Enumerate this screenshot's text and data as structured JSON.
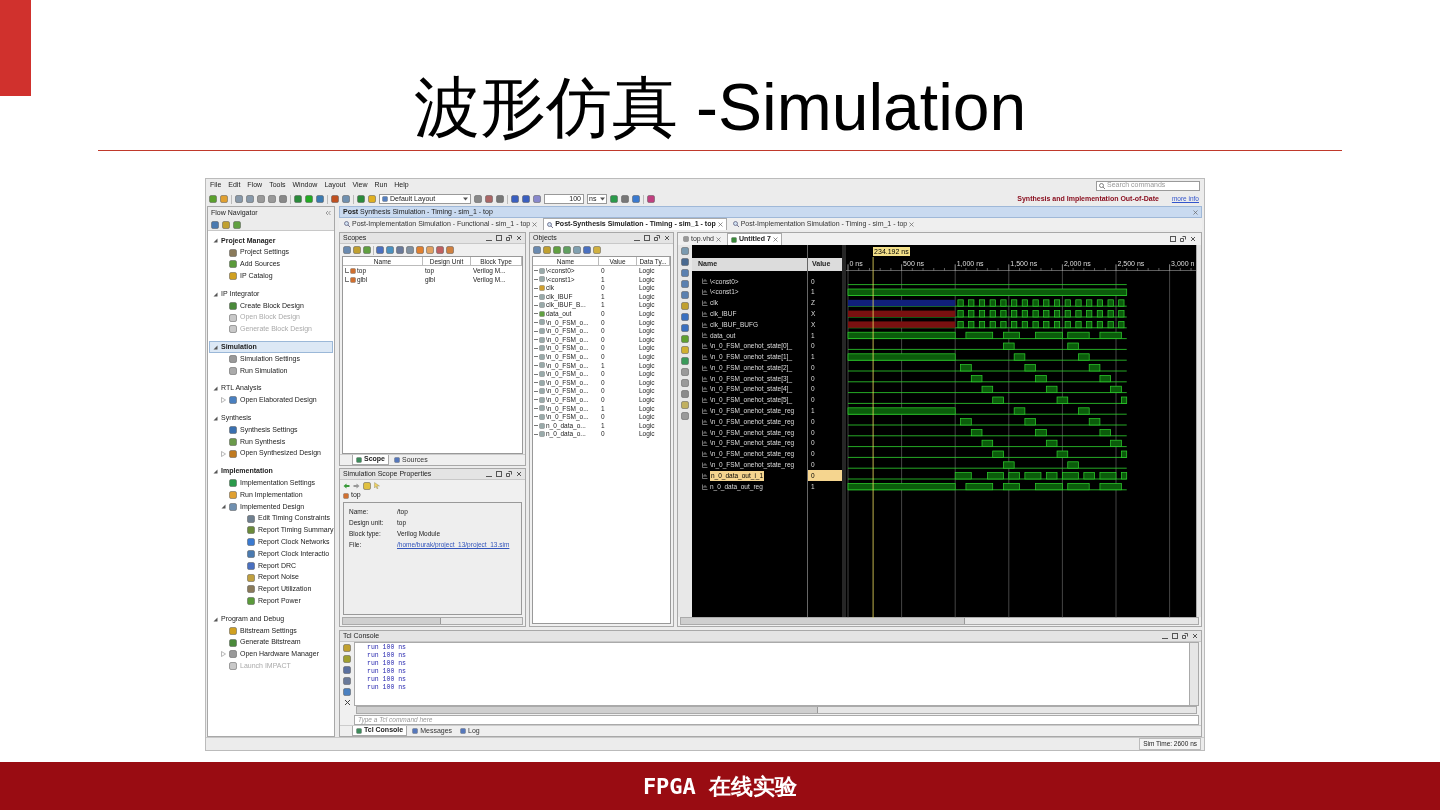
{
  "slide": {
    "title": "波形仿真 -Simulation",
    "footer": "FPGA 在线实验"
  },
  "app": {
    "menu": [
      "File",
      "Edit",
      "Flow",
      "Tools",
      "Window",
      "Layout",
      "View",
      "Run",
      "Help"
    ],
    "search": {
      "placeholder": "Search commands"
    },
    "toolbar": {
      "layout": "Default Layout",
      "run_time": "100",
      "run_unit": "ns"
    },
    "status_message": "Synthesis and Implementation Out-of-Date",
    "more_info": "more info",
    "flow_navigator": {
      "title": "Flow Navigator",
      "sections": [
        {
          "label": "Project Manager",
          "emphasized": true,
          "selected": false,
          "expanded": true,
          "items": [
            {
              "label": "Project Settings",
              "disabled": false
            },
            {
              "label": "Add Sources",
              "disabled": false
            },
            {
              "label": "IP Catalog",
              "disabled": false
            }
          ]
        },
        {
          "label": "IP Integrator",
          "emphasized": false,
          "selected": false,
          "expanded": true,
          "items": [
            {
              "label": "Create Block Design",
              "disabled": false
            },
            {
              "label": "Open Block Design",
              "disabled": true
            },
            {
              "label": "Generate Block Design",
              "disabled": true
            }
          ]
        },
        {
          "label": "Simulation",
          "emphasized": true,
          "selected": true,
          "expanded": true,
          "items": [
            {
              "label": "Simulation Settings",
              "disabled": false
            },
            {
              "label": "Run Simulation",
              "disabled": false
            }
          ]
        },
        {
          "label": "RTL Analysis",
          "emphasized": false,
          "selected": false,
          "expanded": true,
          "items": [
            {
              "label": "Open Elaborated Design",
              "disabled": false,
              "expanded": false
            }
          ]
        },
        {
          "label": "Synthesis",
          "emphasized": false,
          "selected": false,
          "expanded": true,
          "items": [
            {
              "label": "Synthesis Settings",
              "disabled": false
            },
            {
              "label": "Run Synthesis",
              "disabled": false
            },
            {
              "label": "Open Synthesized Design",
              "disabled": false,
              "expanded": false
            }
          ]
        },
        {
          "label": "Implementation",
          "emphasized": true,
          "selected": false,
          "expanded": true,
          "items": [
            {
              "label": "Implementation Settings",
              "disabled": false
            },
            {
              "label": "Run Implementation",
              "disabled": false
            },
            {
              "label": "Implemented Design",
              "disabled": false,
              "expanded": true,
              "children": [
                {
                  "label": "Edit Timing Constraints",
                  "disabled": false
                },
                {
                  "label": "Report Timing Summary",
                  "disabled": false
                },
                {
                  "label": "Report Clock Networks",
                  "disabled": false
                },
                {
                  "label": "Report Clock Interactio",
                  "disabled": false
                },
                {
                  "label": "Report DRC",
                  "disabled": false
                },
                {
                  "label": "Report Noise",
                  "disabled": false
                },
                {
                  "label": "Report Utilization",
                  "disabled": false
                },
                {
                  "label": "Report Power",
                  "disabled": false
                }
              ]
            }
          ]
        },
        {
          "label": "Program and Debug",
          "emphasized": false,
          "selected": false,
          "expanded": true,
          "items": [
            {
              "label": "Bitstream Settings",
              "disabled": false
            },
            {
              "label": "Generate Bitstream",
              "disabled": false
            },
            {
              "label": "Open Hardware Manager",
              "disabled": false,
              "expanded": false
            },
            {
              "label": "Launch IMPACT",
              "disabled": true
            }
          ]
        }
      ]
    },
    "sim_header": "**Post** Synthesis Simulation - Timing - sim_1 - top",
    "document_tabs": [
      {
        "label": "Post-Implementation Simulation - Functional - sim_1 - top",
        "selected": false
      },
      {
        "label": "Post-Synthesis Simulation - Timing - sim_1 - top",
        "selected": true
      },
      {
        "label": "Post-Implementation Simulation - Timing - sim_1 - top",
        "selected": false
      }
    ],
    "scopes": {
      "title": "Scopes",
      "columns": [
        "Name",
        "Design Unit",
        "Block Type"
      ],
      "rows": [
        [
          "top",
          "top",
          "Verilog M..."
        ],
        [
          "glbl",
          "glbl",
          "Verilog M..."
        ]
      ],
      "tabs": [
        {
          "label": "Scope",
          "selected": true
        },
        {
          "label": "Sources",
          "selected": false
        }
      ]
    },
    "scope_properties": {
      "title": "Simulation Scope Properties",
      "scope": "top",
      "properties": [
        {
          "key": "Name:",
          "value": "/top",
          "link": false
        },
        {
          "key": "Design unit:",
          "value": "top",
          "link": false
        },
        {
          "key": "Block type:",
          "value": "Verilog Module",
          "link": false
        },
        {
          "key": "File:",
          "value": "/home/burak/project_13/project_13.sim",
          "link": true
        }
      ]
    },
    "objects": {
      "title": "Objects",
      "columns": [
        "Name",
        "Value",
        "Data Ty..."
      ],
      "rows": [
        [
          "\\<const0>",
          "0",
          "Logic"
        ],
        [
          "\\<const1>",
          "1",
          "Logic"
        ],
        [
          "clk",
          "0",
          "Logic"
        ],
        [
          "clk_IBUF",
          "1",
          "Logic"
        ],
        [
          "clk_IBUF_B...",
          "1",
          "Logic"
        ],
        [
          "data_out",
          "0",
          "Logic"
        ],
        [
          "\\n_0_FSM_o...",
          "0",
          "Logic"
        ],
        [
          "\\n_0_FSM_o...",
          "0",
          "Logic"
        ],
        [
          "\\n_0_FSM_o...",
          "0",
          "Logic"
        ],
        [
          "\\n_0_FSM_o...",
          "0",
          "Logic"
        ],
        [
          "\\n_0_FSM_o...",
          "0",
          "Logic"
        ],
        [
          "\\n_0_FSM_o...",
          "1",
          "Logic"
        ],
        [
          "\\n_0_FSM_o...",
          "0",
          "Logic"
        ],
        [
          "\\n_0_FSM_o...",
          "0",
          "Logic"
        ],
        [
          "\\n_0_FSM_o...",
          "0",
          "Logic"
        ],
        [
          "\\n_0_FSM_o...",
          "0",
          "Logic"
        ],
        [
          "\\n_0_FSM_o...",
          "1",
          "Logic"
        ],
        [
          "\\n_0_FSM_o...",
          "0",
          "Logic"
        ],
        [
          "n_0_data_o...",
          "1",
          "Logic"
        ],
        [
          "n_0_data_o...",
          "0",
          "Logic"
        ]
      ]
    },
    "wave": {
      "tabs": [
        {
          "label": "top.vhd",
          "selected": false
        },
        {
          "label": "Untitled 7",
          "selected": true
        }
      ],
      "columns": [
        "Name",
        "Value"
      ],
      "cursor": "234.192 ns",
      "time_ticks": [
        "0 ns",
        "500 ns",
        "1,000 ns",
        "1,500 ns",
        "2,000 ns",
        "2,500 ns",
        "3,000 n"
      ],
      "signals": [
        {
          "name": "\\<const0>",
          "value": "0",
          "kind": "const_low",
          "selected": false
        },
        {
          "name": "\\<const1>",
          "value": "1",
          "kind": "const_high",
          "selected": false
        },
        {
          "name": "clk",
          "value": "Z",
          "kind": "clock_z",
          "selected": false
        },
        {
          "name": "clk_IBUF",
          "value": "X",
          "kind": "clock_x",
          "selected": false
        },
        {
          "name": "clk_IBUF_BUFG",
          "value": "X",
          "kind": "clock_x",
          "selected": false
        },
        {
          "name": "data_out",
          "value": "1",
          "kind": "data_high_start",
          "selected": false
        },
        {
          "name": "\\n_0_FSM_onehot_state[0]_",
          "value": "0",
          "kind": "onehot",
          "selected": false
        },
        {
          "name": "\\n_0_FSM_onehot_state[1]_",
          "value": "1",
          "kind": "onehot",
          "selected": false
        },
        {
          "name": "\\n_0_FSM_onehot_state[2]_",
          "value": "0",
          "kind": "onehot",
          "selected": false
        },
        {
          "name": "\\n_0_FSM_onehot_state[3]_",
          "value": "0",
          "kind": "onehot",
          "selected": false
        },
        {
          "name": "\\n_0_FSM_onehot_state[4]_",
          "value": "0",
          "kind": "onehot",
          "selected": false
        },
        {
          "name": "\\n_0_FSM_onehot_state[5]_",
          "value": "0",
          "kind": "onehot",
          "selected": false
        },
        {
          "name": "\\n_0_FSM_onehot_state_reg",
          "value": "1",
          "kind": "onehot",
          "selected": false
        },
        {
          "name": "\\n_0_FSM_onehot_state_reg",
          "value": "0",
          "kind": "onehot",
          "selected": false
        },
        {
          "name": "\\n_0_FSM_onehot_state_reg",
          "value": "0",
          "kind": "onehot",
          "selected": false
        },
        {
          "name": "\\n_0_FSM_onehot_state_reg",
          "value": "0",
          "kind": "onehot",
          "selected": false
        },
        {
          "name": "\\n_0_FSM_onehot_state_reg",
          "value": "0",
          "kind": "onehot",
          "selected": false
        },
        {
          "name": "\\n_0_FSM_onehot_state_reg",
          "value": "0",
          "kind": "onehot",
          "selected": false
        },
        {
          "name": "n_0_data_out_i_1",
          "value": "0",
          "kind": "data_low_start",
          "selected": true
        },
        {
          "name": "n_0_data_out_reg",
          "value": "1",
          "kind": "data_high_start",
          "selected": false
        }
      ]
    },
    "tcl": {
      "title": "Tcl Console",
      "lines": [
        "run 100 ns",
        "run 100 ns",
        "run 100 ns",
        "run 100 ns",
        "run 100 ns",
        "run 100 ns"
      ],
      "placeholder": "Type a Tcl command here",
      "tabs": [
        {
          "label": "Tcl Console",
          "selected": true
        },
        {
          "label": "Messages",
          "selected": false
        },
        {
          "label": "Log",
          "selected": false
        }
      ]
    },
    "status_bar": "Sim Time: 2600 ns"
  }
}
